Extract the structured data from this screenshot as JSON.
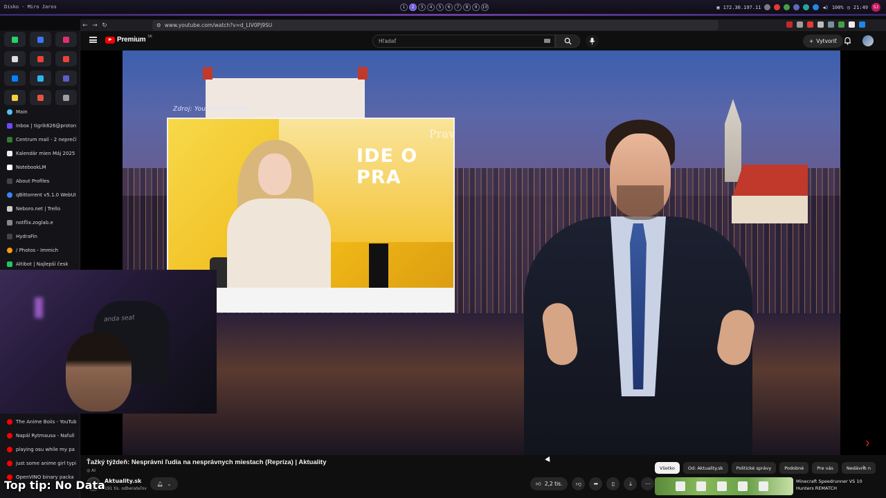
{
  "desktop": {
    "window_title": "Disko - Miro Jaros",
    "workspaces": [
      "1",
      "2",
      "3",
      "4",
      "5",
      "6",
      "7",
      "8",
      "9",
      "10"
    ],
    "active_workspace": "2",
    "ip": "172.30.197.11",
    "volume": "100%",
    "time": "21:49",
    "user_initials": "SJ"
  },
  "browser": {
    "url": "www.youtube.com/watch?v=d_LIV0Pj9SU"
  },
  "sidebar": {
    "pinned": [
      {
        "icon": "whatsapp-icon",
        "color": "#25d366"
      },
      {
        "icon": "signal-icon",
        "color": "#3a76f0"
      },
      {
        "icon": "instagram-icon",
        "color": "#e1306c"
      },
      {
        "icon": "x-icon",
        "color": "#dddddd"
      },
      {
        "icon": "gmail-icon",
        "color": "#ea4335"
      },
      {
        "icon": "gmail-icon",
        "color": "#ea4335"
      },
      {
        "icon": "messenger-icon",
        "color": "#0084ff"
      },
      {
        "icon": "drop-icon",
        "color": "#29b6f6"
      },
      {
        "icon": "teams-icon",
        "color": "#5b5fc7"
      },
      {
        "icon": "note-icon",
        "color": "#f4d03f"
      },
      {
        "icon": "proton-icon",
        "color": "#e5533d"
      },
      {
        "icon": "gear-icon",
        "color": "#9e9e9e"
      }
    ],
    "tabs": [
      {
        "label": "Main",
        "color": "#4fc3f7"
      },
      {
        "label": "Inbox | tigrik626@proton",
        "color": "#6d4aff"
      },
      {
        "label": "Centrum mail - 2 neprečí",
        "color": "#2e7d32"
      },
      {
        "label": "Kalendár mien Máj 2025",
        "color": "#eeeeee"
      },
      {
        "label": "NotebookLM",
        "color": "#ffffff"
      },
      {
        "label": "About Profiles",
        "color": "#444444"
      },
      {
        "label": "qBittorrent v5.1.0 WebUI",
        "color": "#3b82f6"
      },
      {
        "label": "Neboro.net | Trello",
        "color": "#cccccc"
      },
      {
        "label": "notflix.zoglab.e",
        "color": "#888888"
      },
      {
        "label": "HydraFin",
        "color": "#444444"
      },
      {
        "label": "/ Photos - Immich",
        "color": "#f59e0b"
      },
      {
        "label": "Altibot | Najlepší česk",
        "color": "#22c55e"
      }
    ],
    "lower_tabs": [
      {
        "label": "The Anime Boiis - YouTub",
        "color": "#ff0000"
      },
      {
        "label": "Napál Rytmausa - Nafull",
        "color": "#ff0000"
      },
      {
        "label": "playing osu while my pa",
        "color": "#ff0000"
      },
      {
        "label": "just some anime girl typi",
        "color": "#ff0000"
      },
      {
        "label": "OpenVINO binary packa",
        "color": "#ff0000"
      }
    ]
  },
  "youtube": {
    "logo_text": "Premium",
    "region": "SK",
    "search_placeholder": "Hľadať",
    "create_label": "Vytvoriť",
    "video": {
      "source_label": "Zdroj: YouTube / Pravda",
      "inset_headline": "IDE O PRA",
      "inset_brand": "Prav",
      "title": "Ťažký týždeň: Nesprávni ľudia na nesprávnych miestach (Repríza) | Aktuality",
      "ai_badge": "AI",
      "channel_initials": "A.SK",
      "channel": "Aktuality.sk",
      "subscribers": "191 tis. odberateľov",
      "likes": "2,2 tis."
    },
    "chips": [
      "Všetko",
      "Od: Aktuality.sk",
      "Politické správy",
      "Podobné",
      "Pre vás",
      "Nedávno n"
    ],
    "recommendation": {
      "title": "Minecraft Speedrunner VS 10 Hunters REMATCH"
    }
  },
  "overlay": {
    "tip": "Top tip: No Data"
  },
  "webcam": {
    "chair_text": "anda seat"
  }
}
